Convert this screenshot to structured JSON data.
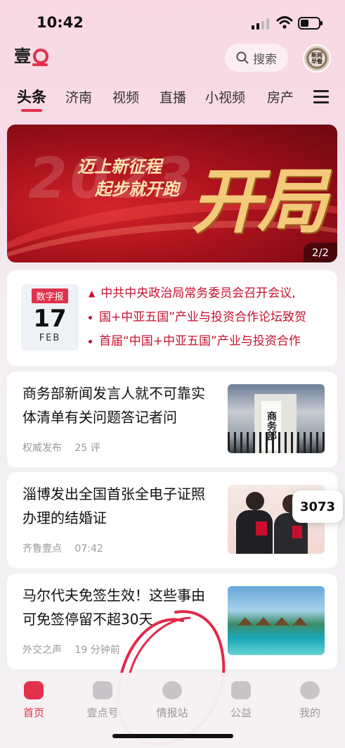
{
  "status_bar": {
    "time": "10:42"
  },
  "header": {
    "search_label": "搜索",
    "avatar_text": "新闻早餐"
  },
  "tabs": [
    {
      "label": "头条"
    },
    {
      "label": "济南"
    },
    {
      "label": "视频"
    },
    {
      "label": "直播"
    },
    {
      "label": "小视频"
    },
    {
      "label": "房产"
    }
  ],
  "banner": {
    "line1": "迈上新征程",
    "line2": "起步就开跑",
    "year": "2023",
    "big_text": "开局",
    "pager": "2/2"
  },
  "digital_paper": {
    "tag": "数字报",
    "day": "17",
    "month": "FEB",
    "headlines": [
      "中共中央政治局常务委员会召开会议,",
      "国+中亚五国”产业与投资合作论坛致贺",
      "首届“中国+中亚五国”产业与投资合作"
    ]
  },
  "news": [
    {
      "title": "商务部新闻发言人就不可靠实体清单有关问题答记者问",
      "source": "权威发布",
      "meta": "25 评"
    },
    {
      "title": "淄博发出全国首张全电子证照办理的结婚证",
      "source": "齐鲁壹点",
      "meta": "07:42"
    },
    {
      "title": "马尔代夫免签生效！这些事由可免签停留不超30天",
      "source": "外交之声",
      "meta": "19 分钟前"
    }
  ],
  "gov_sign": "商务部",
  "floating_badge": "3073",
  "bottom_nav": [
    {
      "label": "首页"
    },
    {
      "label": "壹点号"
    },
    {
      "label": "情报站"
    },
    {
      "label": "公益"
    },
    {
      "label": "我的"
    }
  ],
  "colors": {
    "accent": "#e2324b",
    "headline_red": "#c8102e"
  }
}
